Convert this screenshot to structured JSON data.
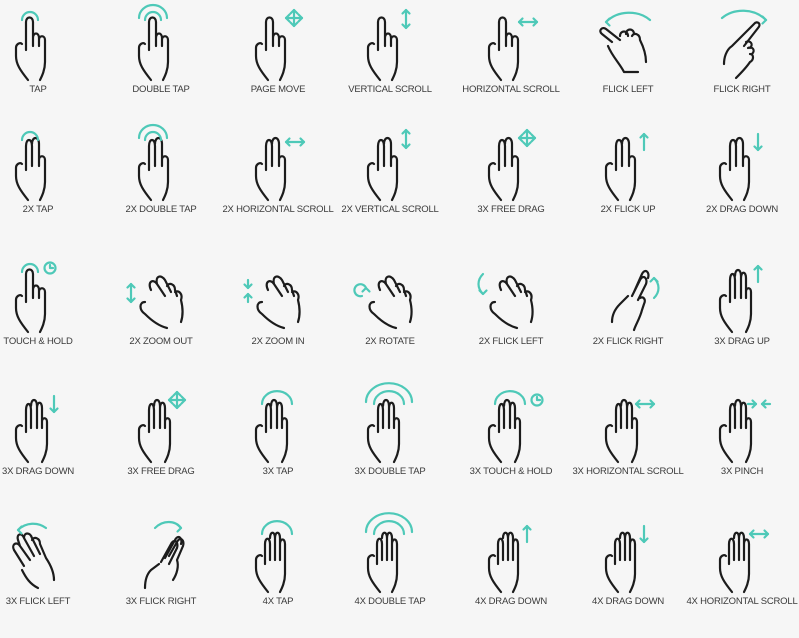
{
  "accent_color": "#4ec9b8",
  "gestures": [
    {
      "label": "TAP",
      "hand": "one",
      "accent": "arc1"
    },
    {
      "label": "DOUBLE TAP",
      "hand": "one",
      "accent": "arc2"
    },
    {
      "label": "PAGE MOVE",
      "hand": "one",
      "accent": "move"
    },
    {
      "label": "VERTICAL SCROLL",
      "hand": "one",
      "accent": "vert"
    },
    {
      "label": "HORIZONTAL SCROLL",
      "hand": "one",
      "accent": "horiz"
    },
    {
      "label": "FLICK LEFT",
      "hand": "one-tilt-left",
      "accent": "curve-left"
    },
    {
      "label": "FLICK RIGHT",
      "hand": "one-tilt-right",
      "accent": "curve-right"
    },
    {
      "label": "2X TAP",
      "hand": "two",
      "accent": "arc1"
    },
    {
      "label": "2X DOUBLE TAP",
      "hand": "two",
      "accent": "arc2"
    },
    {
      "label": "2X HORIZONTAL SCROLL",
      "hand": "two",
      "accent": "horiz"
    },
    {
      "label": "2X VERTICAL SCROLL",
      "hand": "two",
      "accent": "vert"
    },
    {
      "label": "3X FREE DRAG",
      "hand": "two",
      "accent": "move"
    },
    {
      "label": "2X FLICK UP",
      "hand": "two",
      "accent": "up"
    },
    {
      "label": "2X DRAG DOWN",
      "hand": "two",
      "accent": "down"
    },
    {
      "label": "TOUCH & HOLD",
      "hand": "one",
      "accent": "arc1-clock"
    },
    {
      "label": "2X ZOOM OUT",
      "hand": "two-tilt",
      "accent": "vert-left"
    },
    {
      "label": "2X ZOOM IN",
      "hand": "two-tilt",
      "accent": "pinch-v-left"
    },
    {
      "label": "2X ROTATE",
      "hand": "two-tilt",
      "accent": "rotate-left"
    },
    {
      "label": "2X FLICK LEFT",
      "hand": "two-tilt",
      "accent": "bracket-left"
    },
    {
      "label": "2X FLICK RIGHT",
      "hand": "two-tilt-right",
      "accent": "bracket-right"
    },
    {
      "label": "3X DRAG UP",
      "hand": "three",
      "accent": "up"
    },
    {
      "label": "3X DRAG DOWN",
      "hand": "three",
      "accent": "down"
    },
    {
      "label": "3X FREE DRAG",
      "hand": "three",
      "accent": "move"
    },
    {
      "label": "3X TAP",
      "hand": "three",
      "accent": "arc1-wide"
    },
    {
      "label": "3X DOUBLE TAP",
      "hand": "three",
      "accent": "arc2-wide"
    },
    {
      "label": "3X TOUCH & HOLD",
      "hand": "three",
      "accent": "arc1-wide-clock"
    },
    {
      "label": "3X HORIZONTAL SCROLL",
      "hand": "three",
      "accent": "horiz"
    },
    {
      "label": "3X PINCH",
      "hand": "three",
      "accent": "pinch-h"
    },
    {
      "label": "3X FLICK LEFT",
      "hand": "three-tilt-left",
      "accent": "curve-left-small"
    },
    {
      "label": "3X FLICK RIGHT",
      "hand": "three-tilt-right",
      "accent": "curve-right-small"
    },
    {
      "label": "4X TAP",
      "hand": "four",
      "accent": "arc1-wide"
    },
    {
      "label": "4X DOUBLE TAP",
      "hand": "four",
      "accent": "arc2-wide"
    },
    {
      "label": "4X DRAG DOWN",
      "hand": "four",
      "accent": "up"
    },
    {
      "label": "4X DRAG DOWN",
      "hand": "four",
      "accent": "down"
    },
    {
      "label": "4X HORIZONTAL SCROLL",
      "hand": "four",
      "accent": "horiz"
    }
  ]
}
